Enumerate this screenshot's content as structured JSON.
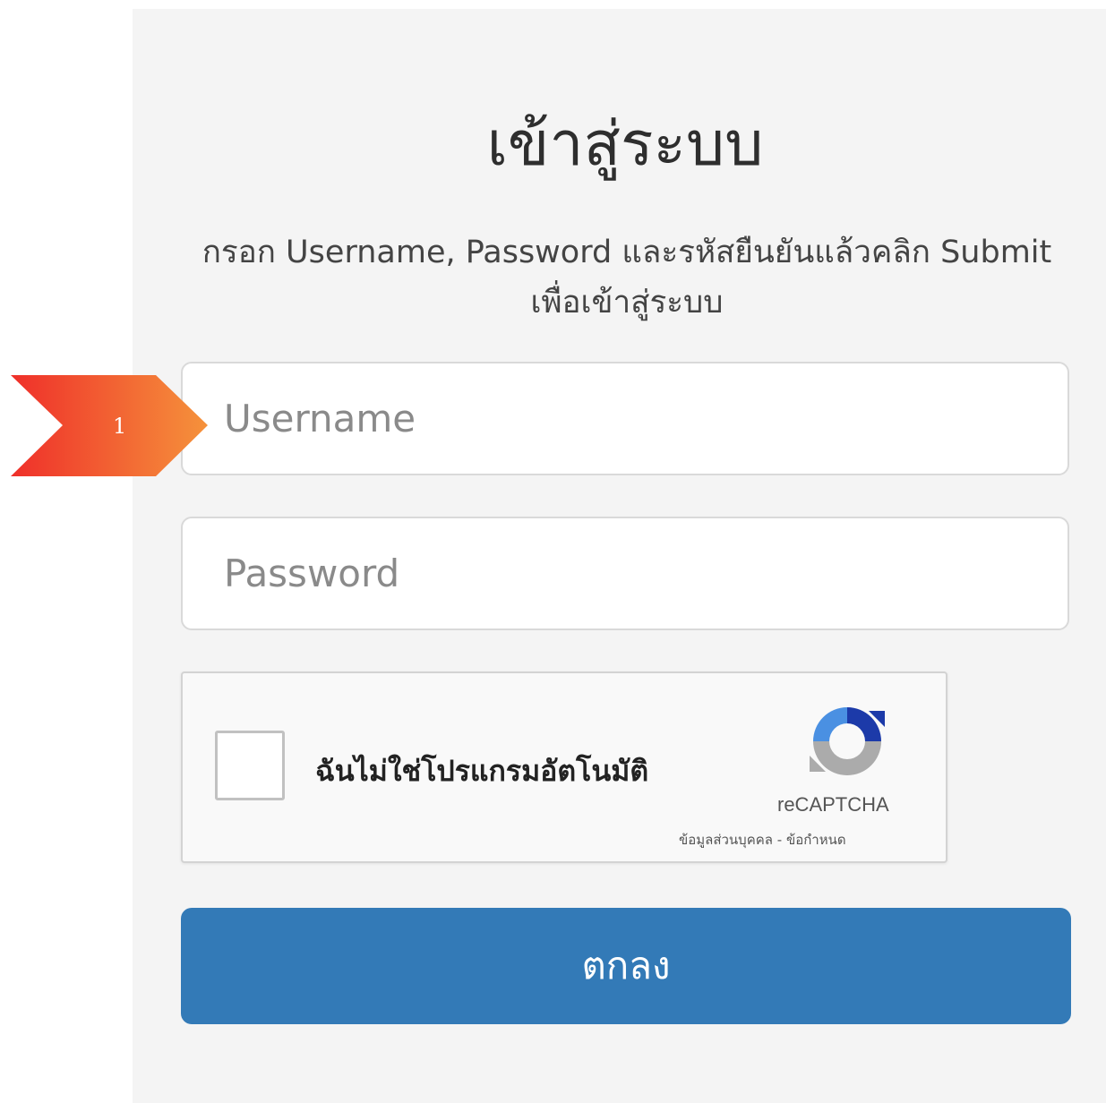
{
  "login": {
    "title": "เข้าสู่ระบบ",
    "instructions": "กรอก Username, Password และรหัสยืนยันแล้วคลิก Submit เพื่อเข้าสู่ระบบ",
    "username_placeholder": "Username",
    "password_placeholder": "Password",
    "submit_label": "ตกลง"
  },
  "annotation": {
    "step_number": "1"
  },
  "captcha": {
    "label": "ฉันไม่ใช่โปรแกรมอัตโนมัติ",
    "brand": "reCAPTCHA",
    "privacy_link": "ข้อมูลส่วนบุคคล",
    "separator": "-",
    "terms_link": "ข้อกำหนด",
    "checked": false
  },
  "colors": {
    "panel_background": "#f4f4f4",
    "button_primary": "#337ab7",
    "marker_start": "#f03a2c",
    "marker_end": "#f5913a"
  }
}
